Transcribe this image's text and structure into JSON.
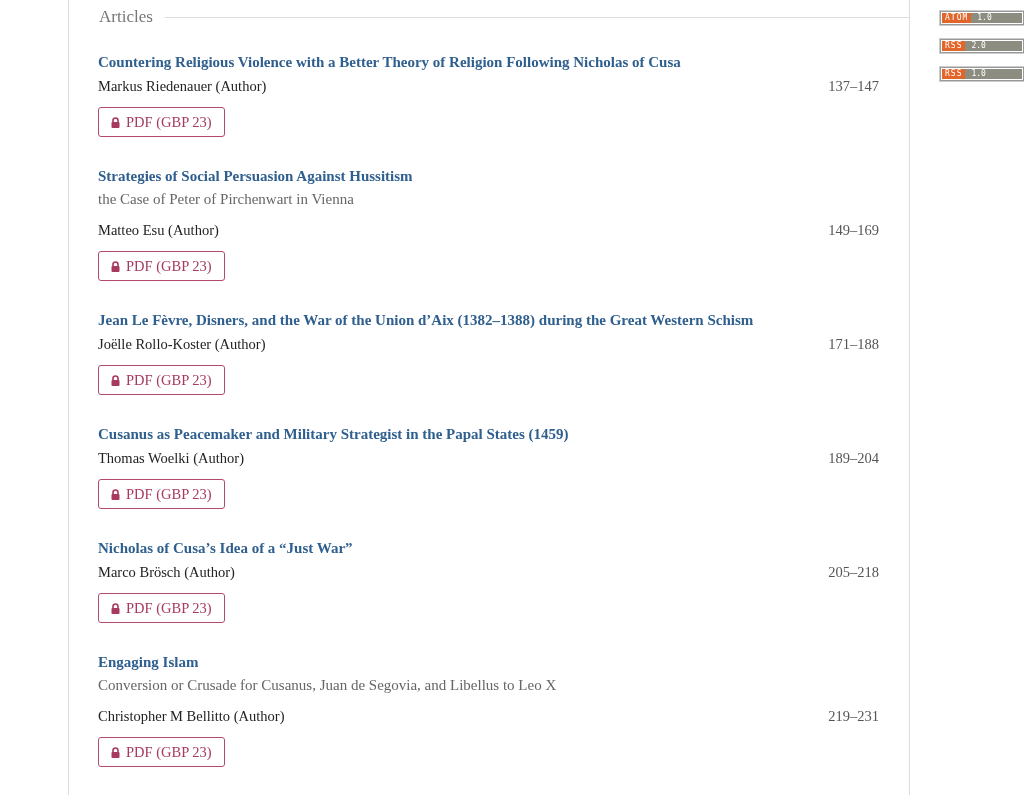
{
  "section": {
    "legend": "Articles"
  },
  "articles": [
    {
      "title": "Countering Religious Violence with a Better Theory of Religion Following Nicholas of Cusa",
      "author": "Markus Riedenauer (Author)",
      "pages": "137–147",
      "button": "PDF (GBP 23)"
    },
    {
      "title": "Strategies of Social Persuasion Against Hussitism",
      "subtitle": "the Case of Peter of Pirchenwart in Vienna",
      "author": "Matteo Esu (Author)",
      "pages": "149–169",
      "button": "PDF (GBP 23)"
    },
    {
      "title": "Jean Le Fèvre, Disners, and the War of the Union d’Aix (1382–1388) during the Great Western Schism",
      "author": "Joëlle Rollo-Koster (Author)",
      "pages": "171–188",
      "button": "PDF (GBP 23)"
    },
    {
      "title": "Cusanus as Peacemaker and Military Strategist in the Papal States (1459)",
      "author": "Thomas Woelki (Author)",
      "pages": "189–204",
      "button": "PDF (GBP 23)"
    },
    {
      "title": "Nicholas of Cusa’s Idea of a “Just War”",
      "author": "Marco Brösch (Author)",
      "pages": "205–218",
      "button": "PDF (GBP 23)"
    },
    {
      "title": "Engaging Islam",
      "subtitle": "Conversion or Crusade for Cusanus, Juan de Segovia, and Libellus to Leo X",
      "author": "Christopher M Bellitto (Author)",
      "pages": "219–231",
      "button": "PDF (GBP 23)"
    }
  ],
  "feeds": [
    {
      "format": "ATOM",
      "version": "1.0"
    },
    {
      "format": "RSS",
      "version": "2.0"
    },
    {
      "format": "RSS",
      "version": "1.0"
    }
  ]
}
